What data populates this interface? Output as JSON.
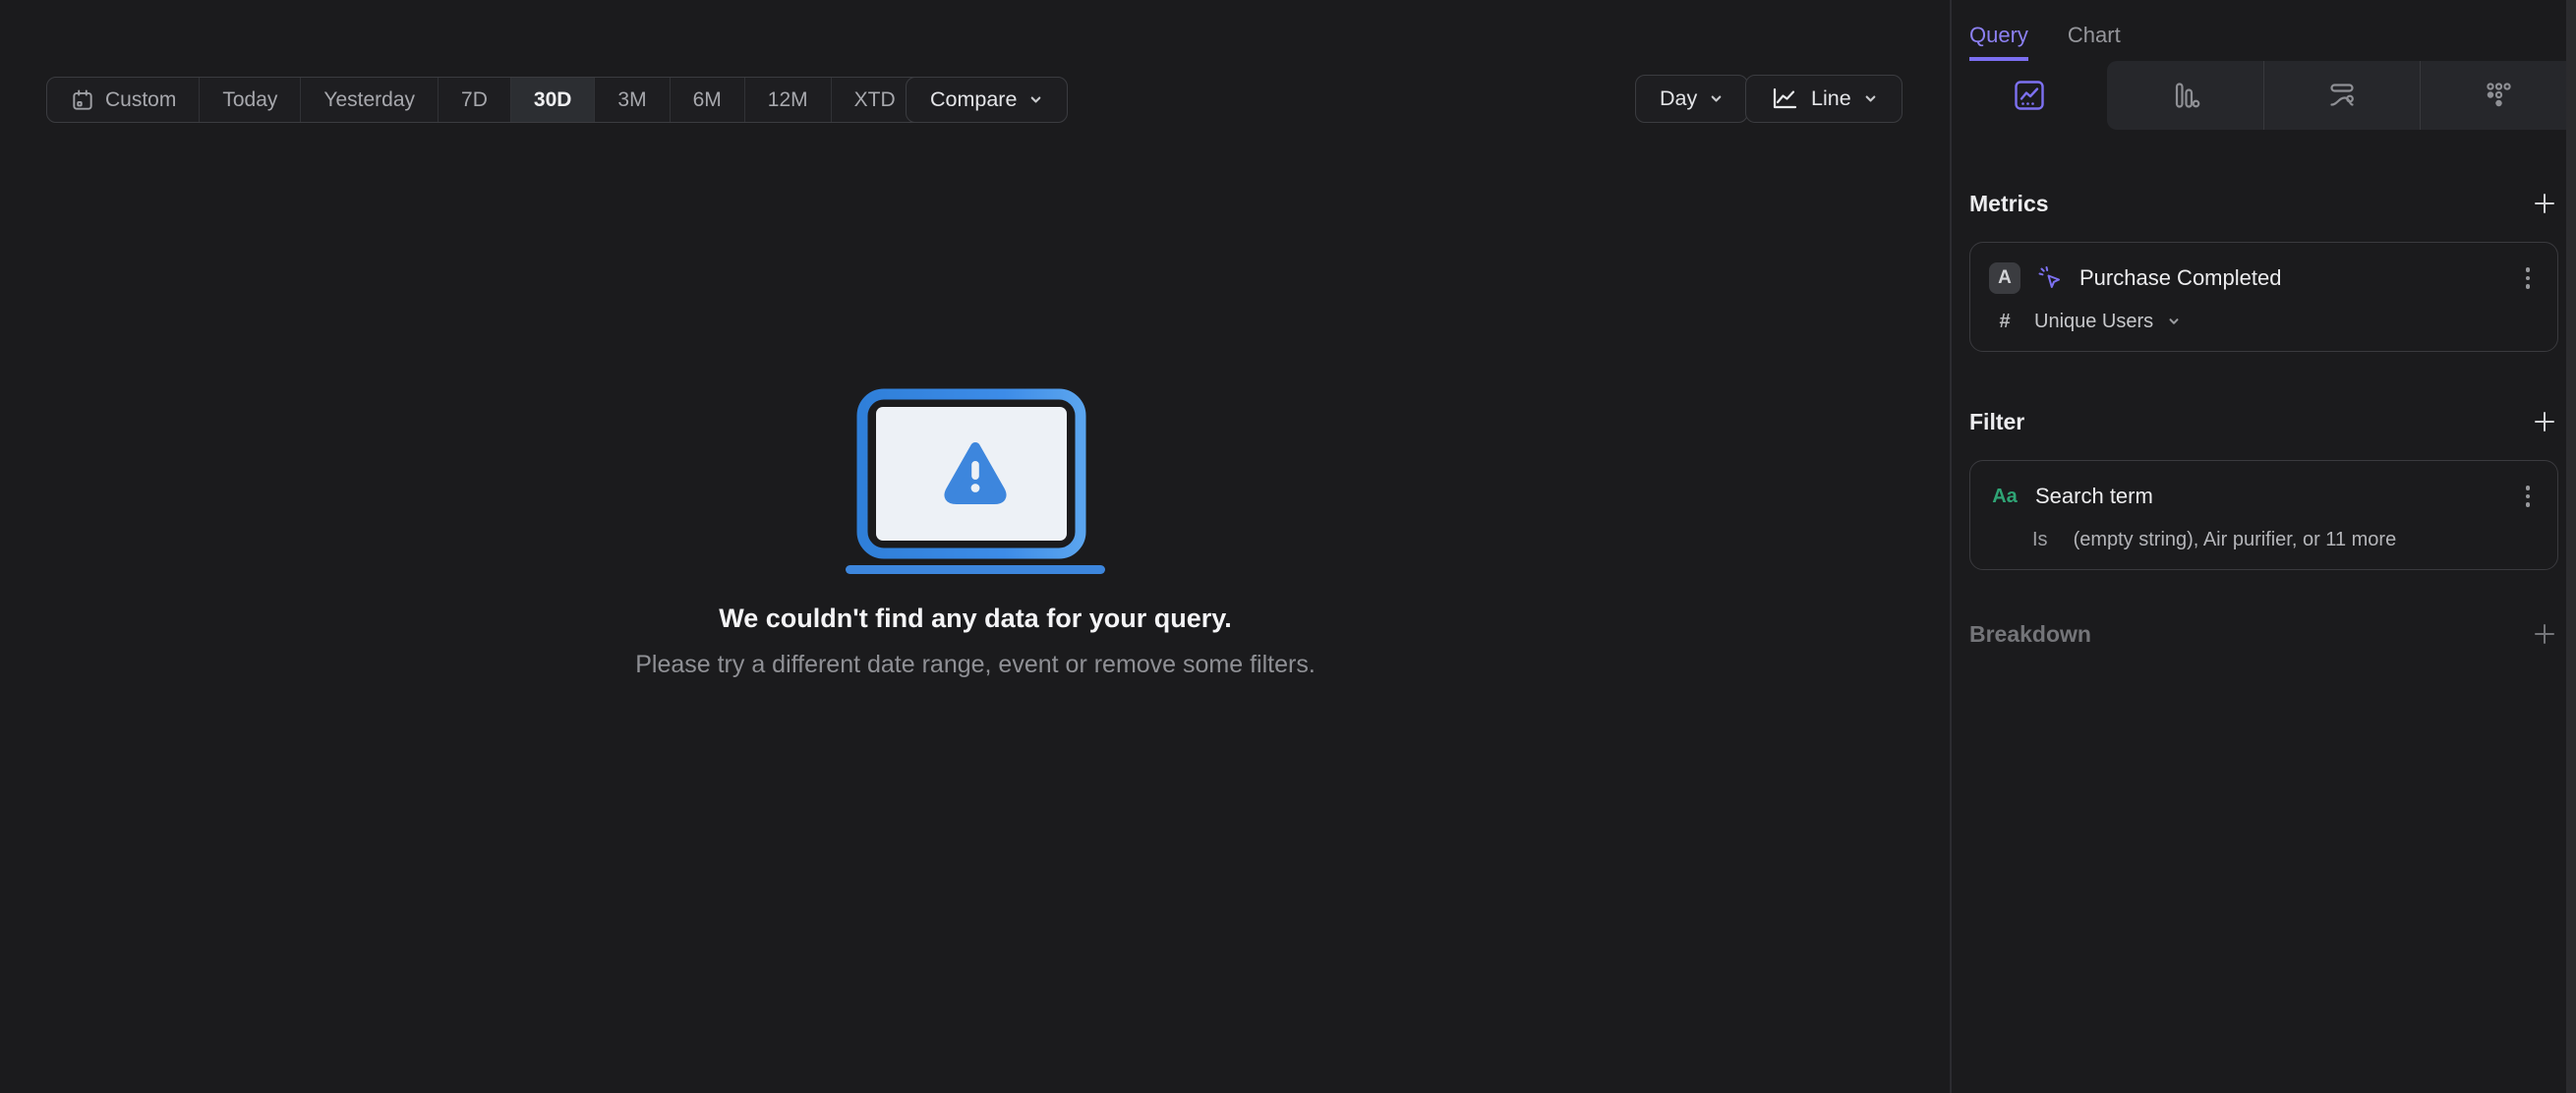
{
  "colors": {
    "accent": "#7d71f2",
    "green": "#2fa475",
    "blue": "#3d86dd"
  },
  "toolbar": {
    "range_labels": [
      "Custom",
      "Today",
      "Yesterday",
      "7D",
      "30D",
      "3M",
      "6M",
      "12M",
      "XTD"
    ],
    "selected_range": "30D",
    "compare_label": "Compare"
  },
  "controls": {
    "interval_label": "Day",
    "chart_type_label": "Line"
  },
  "empty_state": {
    "title": "We couldn't find any data for your query.",
    "subtitle": "Please try a different date range, event or remove some filters."
  },
  "sidebar": {
    "tabs": [
      {
        "label": "Query"
      },
      {
        "label": "Chart"
      }
    ],
    "metrics": {
      "header": "Metrics",
      "items": [
        {
          "letter": "A",
          "name": "Purchase Completed",
          "aggregation_prefix": "#",
          "aggregation": "Unique Users"
        }
      ]
    },
    "filter": {
      "header": "Filter",
      "items": [
        {
          "type_label": "Aa",
          "name": "Search term",
          "operator": "Is",
          "value": "(empty string), Air purifier, or 11 more"
        }
      ]
    },
    "breakdown": {
      "header": "Breakdown"
    }
  }
}
